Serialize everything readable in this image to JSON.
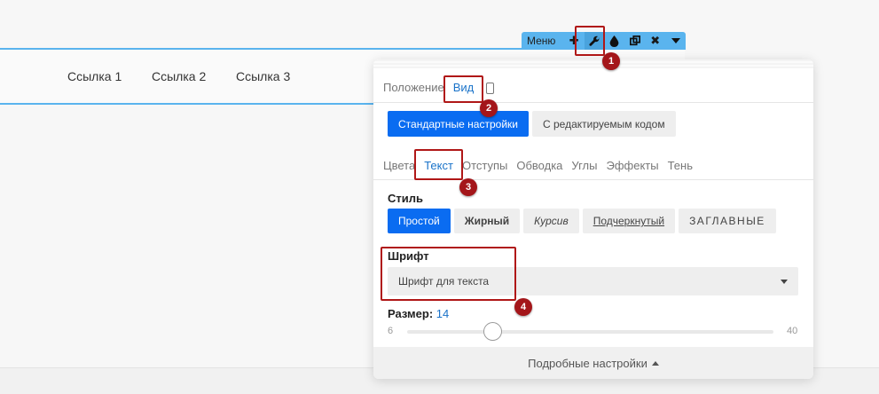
{
  "menu": {
    "links": [
      "Ссылка 1",
      "Ссылка 2",
      "Ссылка 3"
    ]
  },
  "toolbar": {
    "label": "Меню",
    "buttons": [
      {
        "icon": "plus-icon",
        "glyph": "✚"
      },
      {
        "icon": "wrench-icon",
        "glyph": "🔧"
      },
      {
        "icon": "drop-icon",
        "glyph": "💧"
      },
      {
        "icon": "duplicate-icon",
        "glyph": "⧉"
      },
      {
        "icon": "close-icon",
        "glyph": "✖"
      },
      {
        "icon": "caret-down-icon",
        "glyph": "▾"
      }
    ]
  },
  "panel": {
    "tabs": [
      "Положение",
      "Вид"
    ],
    "active_tab": "Вид",
    "modes": [
      "Стандартные настройки",
      "С редактируемым кодом"
    ],
    "subtabs": [
      "Цвета",
      "Текст",
      "Отступы",
      "Обводка",
      "Углы",
      "Эффекты",
      "Тень"
    ],
    "active_subtab": "Текст",
    "style_label": "Стиль",
    "styles": [
      "Простой",
      "Жирный",
      "Курсив",
      "Подчеркнутый",
      "ЗАГЛАВНЫЕ"
    ],
    "font_label": "Шрифт",
    "font_placeholder": "Шрифт для текста",
    "size_label": "Размер:",
    "size_value": "14",
    "size_min": "6",
    "size_max": "40",
    "footer": "Подробные настройки"
  },
  "annotations": [
    "1",
    "2",
    "3",
    "4"
  ],
  "colors": {
    "accent": "#0a6cf1",
    "toolbar": "#5ab4ee",
    "annotation": "#a4161a"
  }
}
